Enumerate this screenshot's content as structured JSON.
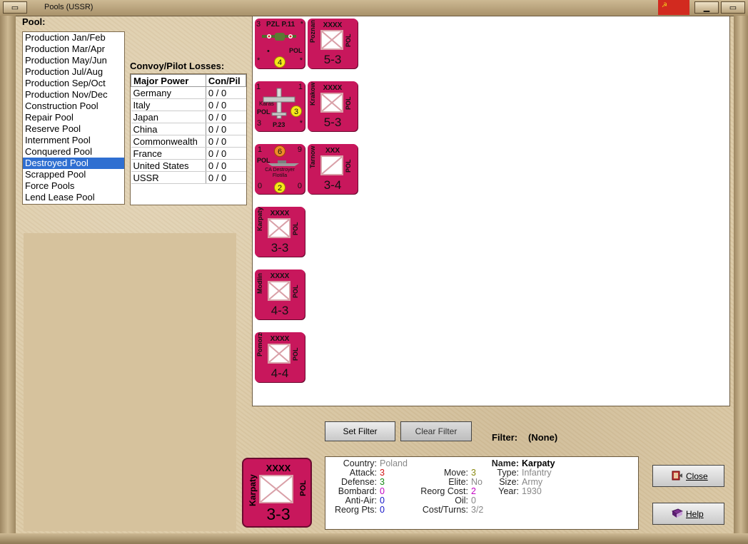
{
  "window": {
    "title": "Pools (USSR)"
  },
  "pool": {
    "label": "Pool:",
    "items": [
      "Production Jan/Feb",
      "Production Mar/Apr",
      "Production May/Jun",
      "Production Jul/Aug",
      "Production Sep/Oct",
      "Production Nov/Dec",
      "Construction Pool",
      "Repair Pool",
      "Reserve Pool",
      "Internment Pool",
      "Conquered Pool",
      "Destroyed Pool",
      "Scrapped Pool",
      "Force Pools",
      "Lend Lease Pool"
    ],
    "selected": "Destroyed Pool"
  },
  "losses": {
    "label": "Convoy/Pilot Losses:",
    "headers": [
      "Major Power",
      "Con/Pil"
    ],
    "rows": [
      [
        "Germany",
        "0 / 0"
      ],
      [
        "Italy",
        "0 / 0"
      ],
      [
        "Japan",
        "0 / 0"
      ],
      [
        "China",
        "0 / 0"
      ],
      [
        "Commonwealth",
        "0 / 0"
      ],
      [
        "France",
        "0 / 0"
      ],
      [
        "United States",
        "0 / 0"
      ],
      [
        "USSR",
        "0 / 0"
      ]
    ]
  },
  "counters": {
    "air1": {
      "name": "PZL P.11",
      "country": "POL",
      "tl": "3",
      "tr": "*",
      "bl": "*",
      "br": "*",
      "circle": "4"
    },
    "air2": {
      "name": "P.23",
      "left_label": "Karas",
      "country": "POL",
      "tl": "1",
      "tr": "1",
      "bl": "3",
      "br": "*",
      "circle": "3"
    },
    "naval": {
      "name": "CA Destroyer Flotilla",
      "country": "POL",
      "tl": "1",
      "tr": "9",
      "bl": "0",
      "br": "0",
      "top_circle": "6",
      "bottom_circle": "2"
    },
    "poznan": {
      "size": "XXXX",
      "name": "Poznan",
      "country": "POL",
      "strength": "5-3"
    },
    "krakow": {
      "size": "XXXX",
      "name": "Krakow",
      "country": "POL",
      "strength": "5-3"
    },
    "tarnow": {
      "size": "XXX",
      "name": "Tarnow",
      "country": "POL",
      "strength": "3-4"
    },
    "karpaty": {
      "size": "XXXX",
      "name": "Karpaty",
      "country": "POL",
      "strength": "3-3"
    },
    "modlin": {
      "size": "XXXX",
      "name": "Modlin",
      "country": "POL",
      "strength": "4-3"
    },
    "pomorze": {
      "size": "XXXX",
      "name": "Pomorze",
      "country": "POL",
      "strength": "4-4"
    }
  },
  "filter": {
    "set_label": "Set Filter",
    "clear_label": "Clear Filter",
    "label": "Filter:",
    "value": "(None)"
  },
  "selected_unit": {
    "size": "XXXX",
    "name": "Karpaty",
    "country": "POL",
    "strength": "3-3",
    "details": {
      "country": "Poland",
      "attack": "3",
      "defense": "3",
      "bombard": "0",
      "anti_air": "0",
      "reorg_pts": "0",
      "move": "3",
      "elite": "No",
      "reorg_cost": "2",
      "oil": "0",
      "cost_turns": "3/2",
      "name": "Karpaty",
      "type": "Infantry",
      "size": "Army",
      "year": "1930"
    },
    "labels": {
      "country": "Country:",
      "attack": "Attack:",
      "defense": "Defense:",
      "bombard": "Bombard:",
      "anti_air": "Anti-Air:",
      "reorg_pts": "Reorg Pts:",
      "move": "Move:",
      "elite": "Elite:",
      "reorg_cost": "Reorg Cost:",
      "oil": "Oil:",
      "cost_turns": "Cost/Turns:",
      "name": "Name:",
      "type": "Type:",
      "size": "Size:",
      "year": "Year:"
    }
  },
  "buttons": {
    "close": "Close",
    "help": "Help"
  },
  "colors": {
    "counter": "#c8175c",
    "selection": "#2f6fd1",
    "flag": "#d22a1f"
  }
}
